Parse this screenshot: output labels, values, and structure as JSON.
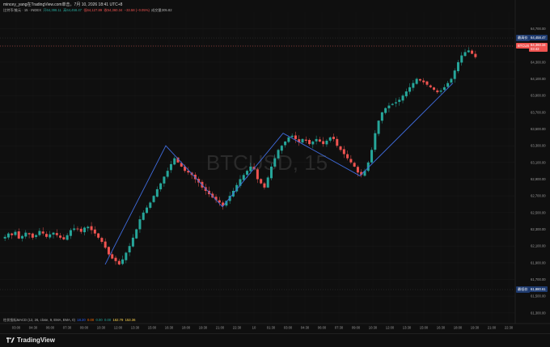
{
  "header": {
    "text": "mincey_yang在TradingView.com单击，7月 10, 2026 18:41 UTC+8"
  },
  "symbol_info": {
    "name": "比特币/美元 · 15 · INDEX",
    "open": "开64,398.11",
    "high": "高64,458.47",
    "low": "低64,127.89",
    "close": "收64,360.34",
    "change": "−33.58 (−0.05%)",
    "extra": "成交量305.82"
  },
  "watermark": "BTCUSD, 15",
  "price_labels": {
    "max_tag": "最高价",
    "max_value": "64,458.47",
    "symbol_tag": "BTCUSD",
    "current_value": "64,360.34",
    "countdown": "03:43",
    "min_tag": "最低价",
    "min_value": "61,880.61"
  },
  "indicator": {
    "name": "柱状指标MACD (12, 26, close, 9, EMA, EMA, 0)",
    "v1": "18.20",
    "v2": "0.00",
    "v3": "0.00",
    "v4": "0.00",
    "v5": "162.79",
    "v6": "153.36"
  },
  "footer": {
    "logo_text": "TradingView"
  },
  "chart_data": {
    "type": "candlestick",
    "y_ticks": [
      64700,
      64500,
      64300,
      64100,
      63900,
      63700,
      63500,
      63300,
      63100,
      62900,
      62700,
      62500,
      62300,
      62100,
      61900,
      61700,
      61500,
      61300
    ],
    "y_tick_labels": [
      "64,700.00",
      "64,500.00",
      "64,300.00",
      "64,100.00",
      "63,900.00",
      "63,700.00",
      "63,500.00",
      "63,300.00",
      "63,100.00",
      "62,900.00",
      "62,700.00",
      "62,500.00",
      "62,300.00",
      "62,100.00",
      "61,900.00",
      "61,700.00",
      "61,500.00",
      "61,300.00"
    ],
    "ylim": [
      61250,
      64850
    ],
    "x_tick_labels": [
      "03:00",
      "04:30",
      "06:00",
      "07:30",
      "09:00",
      "10:30",
      "12:00",
      "13:30",
      "15:00",
      "16:30",
      "18:00",
      "19:30",
      "21:00",
      "22:30",
      "10",
      "01:30",
      "03:00",
      "04:30",
      "06:00",
      "07:30",
      "09:00",
      "10:30",
      "12:00",
      "13:30",
      "15:00",
      "16:30",
      "18:00",
      "19:30",
      "21:00",
      "22:30"
    ],
    "zigzag": [
      [
        130,
        61880
      ],
      [
        205,
        63300
      ],
      [
        275,
        62570
      ],
      [
        350,
        63450
      ],
      [
        445,
        62940
      ],
      [
        560,
        64050
      ]
    ],
    "colors": {
      "up": "#26a69a",
      "down": "#ef5350",
      "zigzag": "#3f6bdc"
    },
    "seed_closes": [
      62210,
      62250,
      62230,
      62270,
      62190,
      62220,
      62260,
      62240,
      62200,
      62230,
      62280,
      62250,
      62210,
      62240,
      62260,
      62230,
      62200,
      62180,
      62230,
      62290,
      62310,
      62300,
      62270,
      62320,
      62330,
      62290,
      62250,
      62200,
      62150,
      62080,
      62000,
      61950,
      61920,
      61880,
      61940,
      62020,
      62100,
      62200,
      62300,
      62420,
      62500,
      62560,
      62620,
      62700,
      62780,
      62850,
      62930,
      63000,
      63080,
      63150,
      63100,
      63050,
      63000,
      62980,
      62950,
      62900,
      62860,
      62800,
      62760,
      62720,
      62680,
      62650,
      62620,
      62580,
      62640,
      62700,
      62760,
      62830,
      62900,
      62950,
      63000,
      63050,
      63020,
      62900,
      62850,
      62800,
      62920,
      63050,
      63150,
      63250,
      63300,
      63350,
      63400,
      63420,
      63380,
      63340,
      63380,
      63360,
      63320,
      63350,
      63380,
      63350,
      63320,
      63360,
      63400,
      63380,
      63300,
      63250,
      63200,
      63150,
      63100,
      63050,
      62980,
      62950,
      63000,
      63100,
      63250,
      63450,
      63600,
      63700,
      63750,
      63780,
      63800,
      63820,
      63850,
      63900,
      63950,
      64000,
      64050,
      64100,
      64080,
      64060,
      64030,
      64000,
      63970,
      63940,
      63960,
      64000,
      64050,
      64100,
      64200,
      64300,
      64380,
      64420,
      64440,
      64400,
      64360
    ]
  }
}
